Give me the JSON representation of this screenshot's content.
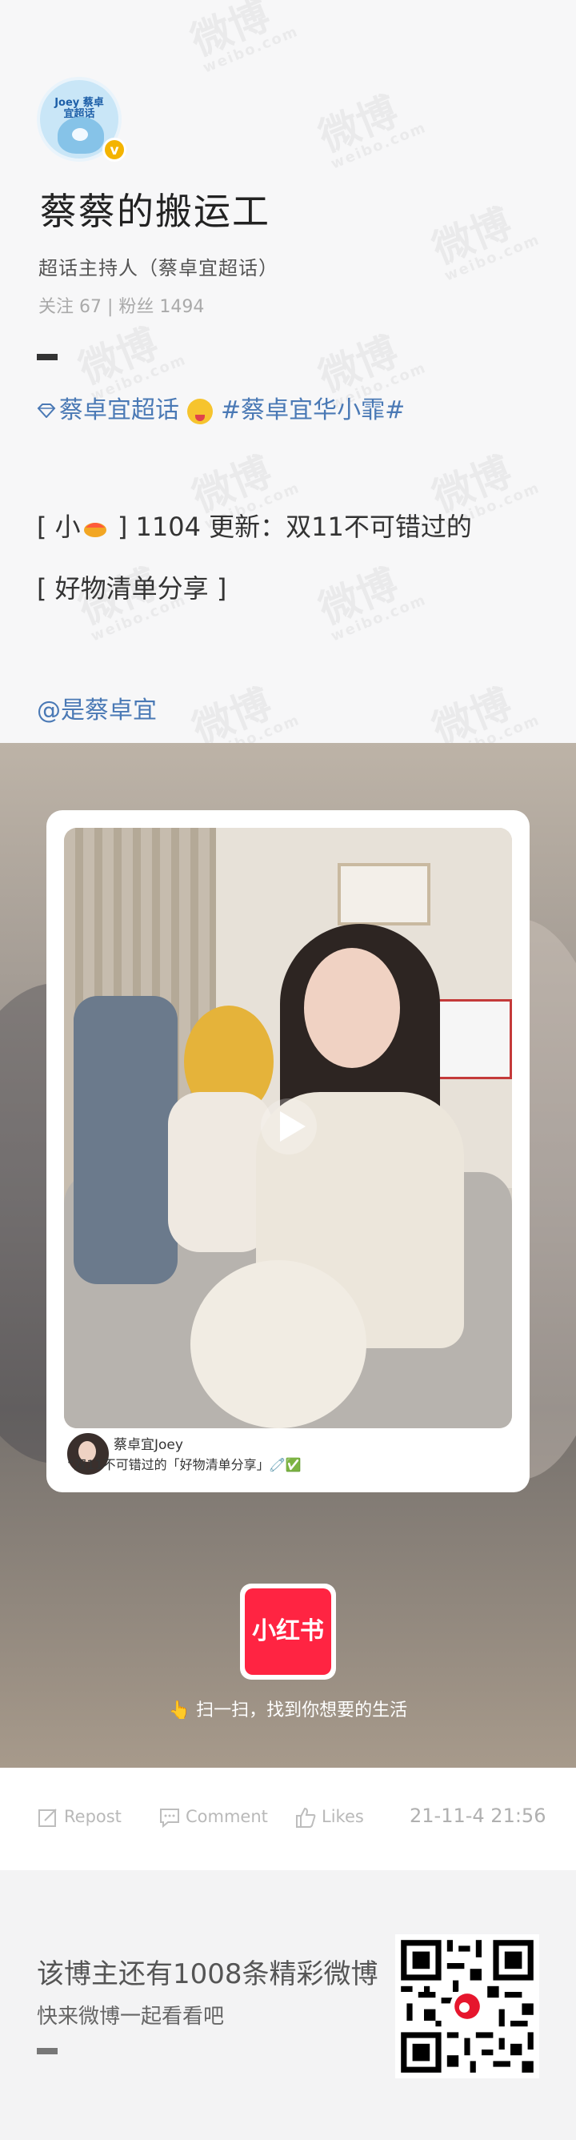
{
  "watermark": {
    "brand": "微博",
    "domain": "weibo.com"
  },
  "profile": {
    "avatar_label": "Joey 蔡卓宜超话",
    "name": "蔡蔡的搬运工",
    "role": "超话主持人（蔡卓宜超话）",
    "stats": "关注 67 | 粉丝 1494"
  },
  "post": {
    "tag1": "蔡卓宜超话",
    "tag2": "#蔡卓宜华小霏#",
    "line1_prefix": "[ 小",
    "line1_suffix": " ] 1104 更新：双11不可错过的",
    "line2": "[ 好物清单分享 ]",
    "mention": "@是蔡卓宜"
  },
  "card": {
    "user": "蔡卓宜Joey",
    "caption": "“双11不可错过的「好物清单分享」🧷✅"
  },
  "xhs": {
    "logo_text": "小红书",
    "scan_text": "👆 扫一扫，找到你想要的生活"
  },
  "actions": {
    "repost": "Repost",
    "comment": "Comment",
    "likes": "Likes",
    "timestamp": "21-11-4 21:56"
  },
  "footer": {
    "title": "该博主还有1008条精彩微博",
    "subtitle": "快来微博一起看看吧"
  },
  "colors": {
    "link_blue": "#4a79b5",
    "verified_gold": "#f4b400",
    "xhs_red": "#ff2442"
  }
}
